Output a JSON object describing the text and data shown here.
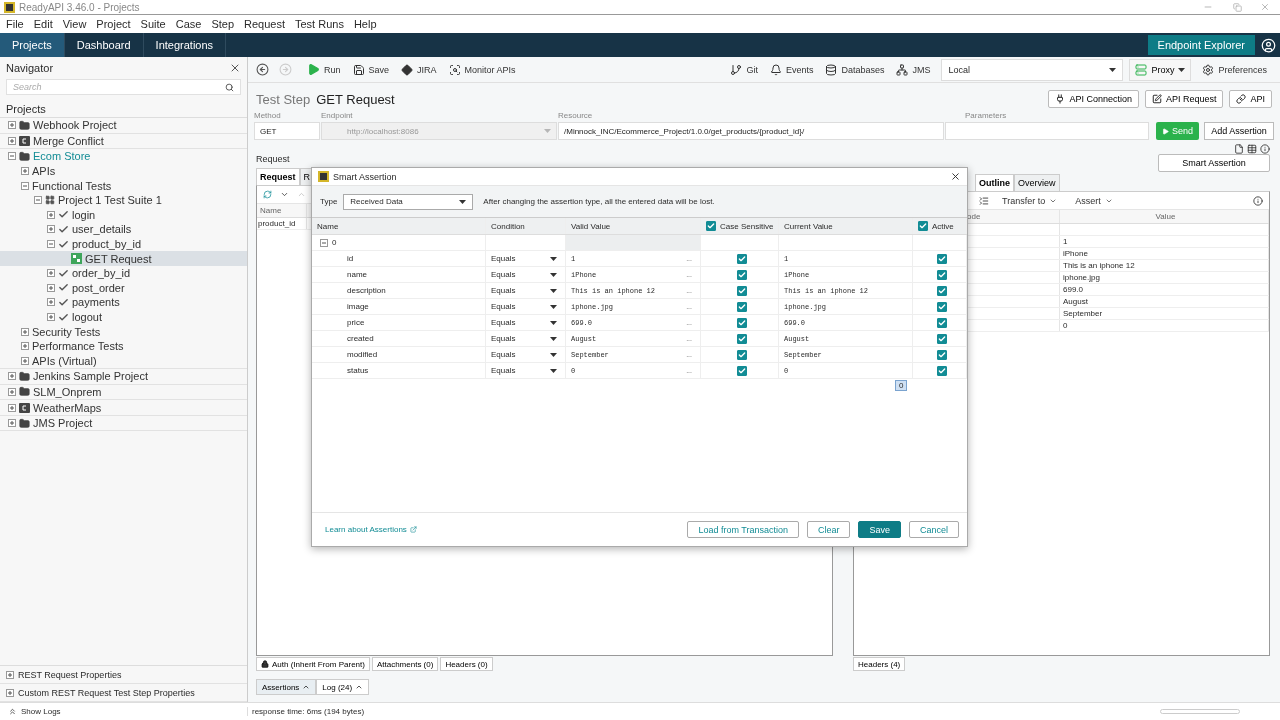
{
  "window": {
    "title": "ReadyAPI 3.46.0 - Projects"
  },
  "menu": [
    "File",
    "Edit",
    "View",
    "Project",
    "Suite",
    "Case",
    "Step",
    "Request",
    "Test Runs",
    "Help"
  ],
  "nav_tabs": [
    {
      "label": "Projects",
      "selected": true
    },
    {
      "label": "Dashboard",
      "selected": false
    },
    {
      "label": "Integrations",
      "selected": false
    }
  ],
  "endpoint_explorer": "Endpoint Explorer",
  "navigator": {
    "title": "Navigator",
    "search_placeholder": "Search",
    "section": "Projects",
    "tree": [
      {
        "label": "Webhook Project",
        "kind": "project",
        "expanded": false,
        "active": false,
        "selected": false
      },
      {
        "label": "Merge Conflict",
        "kind": "composite",
        "expanded": false,
        "active": false,
        "selected": false
      },
      {
        "label": "Ecom Store",
        "kind": "project",
        "expanded": true,
        "active": true,
        "selected": false,
        "children": [
          {
            "label": "APIs",
            "expanded": false,
            "selected": false
          },
          {
            "label": "Functional Tests",
            "expanded": true,
            "selected": false,
            "children": [
              {
                "label": "Project 1 Test Suite 1",
                "kind": "suite",
                "expanded": true,
                "selected": false,
                "children": [
                  {
                    "label": "login",
                    "kind": "case",
                    "expanded": false,
                    "selected": false
                  },
                  {
                    "label": "user_details",
                    "kind": "case",
                    "expanded": false,
                    "selected": false
                  },
                  {
                    "label": "product_by_id",
                    "kind": "case",
                    "expanded": true,
                    "selected": false,
                    "children": [
                      {
                        "label": "GET Request",
                        "kind": "step",
                        "selected": true
                      }
                    ]
                  },
                  {
                    "label": "order_by_id",
                    "kind": "case",
                    "expanded": false,
                    "selected": false
                  },
                  {
                    "label": "post_order",
                    "kind": "case",
                    "expanded": false,
                    "selected": false
                  },
                  {
                    "label": "payments",
                    "kind": "case",
                    "expanded": false,
                    "selected": false
                  },
                  {
                    "label": "logout",
                    "kind": "case",
                    "expanded": false,
                    "selected": false
                  }
                ]
              }
            ]
          },
          {
            "label": "Security Tests",
            "expanded": false,
            "selected": false
          },
          {
            "label": "Performance Tests",
            "expanded": false,
            "selected": false
          },
          {
            "label": "APIs (Virtual)",
            "expanded": false,
            "selected": false
          }
        ]
      },
      {
        "label": "Jenkins Sample Project",
        "kind": "project",
        "expanded": false,
        "active": false,
        "selected": false
      },
      {
        "label": "SLM_Onprem",
        "kind": "project",
        "expanded": false,
        "active": false,
        "selected": false
      },
      {
        "label": "WeatherMaps",
        "kind": "composite",
        "expanded": false,
        "active": false,
        "selected": false
      },
      {
        "label": "JMS Project",
        "kind": "project",
        "expanded": false,
        "active": false,
        "selected": false
      }
    ],
    "properties": [
      "REST Request Properties",
      "Custom REST Request Test Step Properties"
    ]
  },
  "toolbar": {
    "left": [
      {
        "label": "Run",
        "kind": "run"
      },
      {
        "label": "Save",
        "kind": "save"
      },
      {
        "label": "JIRA",
        "kind": "jira"
      },
      {
        "label": "Monitor APIs",
        "kind": "monitor"
      }
    ],
    "right": [
      {
        "label": "Git",
        "kind": "git"
      },
      {
        "label": "Events",
        "kind": "events"
      },
      {
        "label": "Databases",
        "kind": "databases"
      },
      {
        "label": "JMS",
        "kind": "jms"
      }
    ],
    "environment": "Local",
    "proxy": "Proxy",
    "preferences": "Preferences"
  },
  "test_step": {
    "label": "Test Step",
    "name": "GET Request",
    "buttons": [
      {
        "label": "API Connection",
        "kind": "plug"
      },
      {
        "label": "API Request",
        "kind": "edit"
      },
      {
        "label": "API",
        "kind": "link"
      }
    ]
  },
  "fields": {
    "method": {
      "label": "Method",
      "value": "GET"
    },
    "endpoint": {
      "label": "Endpoint",
      "value": "http://localhost:8086",
      "disabled": true
    },
    "resource": {
      "label": "Resource",
      "value": "/Minnock_INC/Ecommerce_Project/1.0.0/get_products/{product_id}/"
    },
    "parameters": {
      "label": "Parameters"
    },
    "send": "Send",
    "add_assertion": "Add Assertion"
  },
  "request_panel": {
    "title": "Request",
    "tabs": [
      {
        "label": "Request",
        "selected": true
      },
      {
        "label": "R",
        "selected": false
      }
    ],
    "column": "Name",
    "rows": [
      "product_id"
    ],
    "bottom_tabs": [
      "Auth (Inherit From Parent)",
      "Attachments (0)",
      "Headers (0)"
    ]
  },
  "response_panel": {
    "button": "Smart Assertion",
    "tabs": [
      {
        "label": "Outline",
        "selected": true
      },
      {
        "label": "Overview",
        "selected": false
      }
    ],
    "tools": [
      "Transfer to",
      "Assert"
    ],
    "columns": [
      "ode",
      "Value"
    ],
    "values": [
      "1",
      "iPhone",
      "This is an iphone 12",
      "iphone.jpg",
      "699.0",
      "August",
      "September",
      "0"
    ],
    "bottom_tabs": [
      "Headers (4)"
    ]
  },
  "bottom_tabs": [
    {
      "label": "Assertions",
      "selected": true
    },
    {
      "label": "Log (24)",
      "selected": false
    }
  ],
  "status": {
    "show_logs": "Show Logs",
    "response_time": "response time: 6ms (194 bytes)"
  },
  "dialog": {
    "title": "Smart Assertion",
    "type_label": "Type",
    "type_value": "Received Data",
    "warning": "After changing the assertion type, all the entered data will be lost.",
    "columns": [
      "Name",
      "Condition",
      "Valid Value",
      "Case Sensitive",
      "Current Value",
      "Active"
    ],
    "case_sensitive_all": true,
    "active_all": true,
    "group": {
      "label": "0",
      "expanded": true
    },
    "rows": [
      {
        "name": "id",
        "condition": "Equals",
        "valid_value": "1",
        "editor": "...",
        "case_sensitive": true,
        "current_value": "1",
        "active": true
      },
      {
        "name": "name",
        "condition": "Equals",
        "valid_value": "iPhone",
        "editor": "...",
        "case_sensitive": true,
        "current_value": "iPhone",
        "active": true
      },
      {
        "name": "description",
        "condition": "Equals",
        "valid_value": "This is an iphone 12",
        "editor": "...",
        "case_sensitive": true,
        "current_value": "This is an iphone 12",
        "active": true
      },
      {
        "name": "image",
        "condition": "Equals",
        "valid_value": "iphone.jpg",
        "editor": "...",
        "case_sensitive": true,
        "current_value": "iphone.jpg",
        "active": true
      },
      {
        "name": "price",
        "condition": "Equals",
        "valid_value": "699.0",
        "editor": "...",
        "case_sensitive": true,
        "current_value": "699.0",
        "active": true
      },
      {
        "name": "created",
        "condition": "Equals",
        "valid_value": "August",
        "editor": "...",
        "case_sensitive": true,
        "current_value": "August",
        "active": true
      },
      {
        "name": "modified",
        "condition": "Equals",
        "valid_value": "September",
        "editor": "...",
        "case_sensitive": true,
        "current_value": "September",
        "active": true
      },
      {
        "name": "status",
        "condition": "Equals",
        "valid_value": "0",
        "editor": "...",
        "case_sensitive": true,
        "current_value": "0",
        "active": true
      }
    ],
    "cell_tip": "0",
    "link": "Learn about Assertions",
    "buttons": [
      {
        "label": "Load from Transaction",
        "kind": "default"
      },
      {
        "label": "Clear",
        "kind": "default"
      },
      {
        "label": "Save",
        "kind": "primary"
      },
      {
        "label": "Cancel",
        "kind": "default"
      }
    ]
  }
}
